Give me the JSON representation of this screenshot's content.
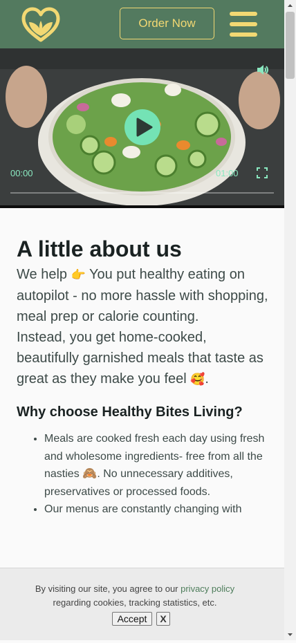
{
  "header": {
    "order_button": "Order Now",
    "logo_icon": "heart-leaf-logo-icon",
    "menu_icon": "hamburger-menu-icon",
    "colors": {
      "background": "#537a5f",
      "accent": "#f2d873"
    }
  },
  "video": {
    "current_time": "00:00",
    "duration": "01:00",
    "progress": 0,
    "icons": {
      "play": "play-icon",
      "volume": "volume-icon",
      "fullscreen": "fullscreen-icon"
    },
    "accent": "#74e3b5"
  },
  "about": {
    "heading": "A little about us",
    "intro_part1": "We help ",
    "emoji_point": "👉",
    "intro_part2": " You put healthy eating on autopilot - no more hassle with shopping, meal prep or calorie counting.",
    "intro_part3": "Instead, you get home-cooked, beautifully garnished meals that taste as great as they make you feel ",
    "emoji_love": "🥰",
    "intro_end": ".",
    "why_heading": "Why choose Healthy Bites Living?",
    "bullet1_part1": "Meals are cooked fresh each day using fresh and wholesome ingredients- free from all the nasties ",
    "bullet1_emoji": "🙈",
    "bullet1_part2": ". No unnecessary additives, preservatives or processed foods.",
    "bullet2": "Our menus are constantly changing with"
  },
  "cookie": {
    "text_before": "By visiting our site, you agree to our ",
    "link": "privacy policy",
    "text_after": "regarding cookies, tracking statistics, etc.",
    "accept_button": "Accept",
    "close_button": "X"
  }
}
